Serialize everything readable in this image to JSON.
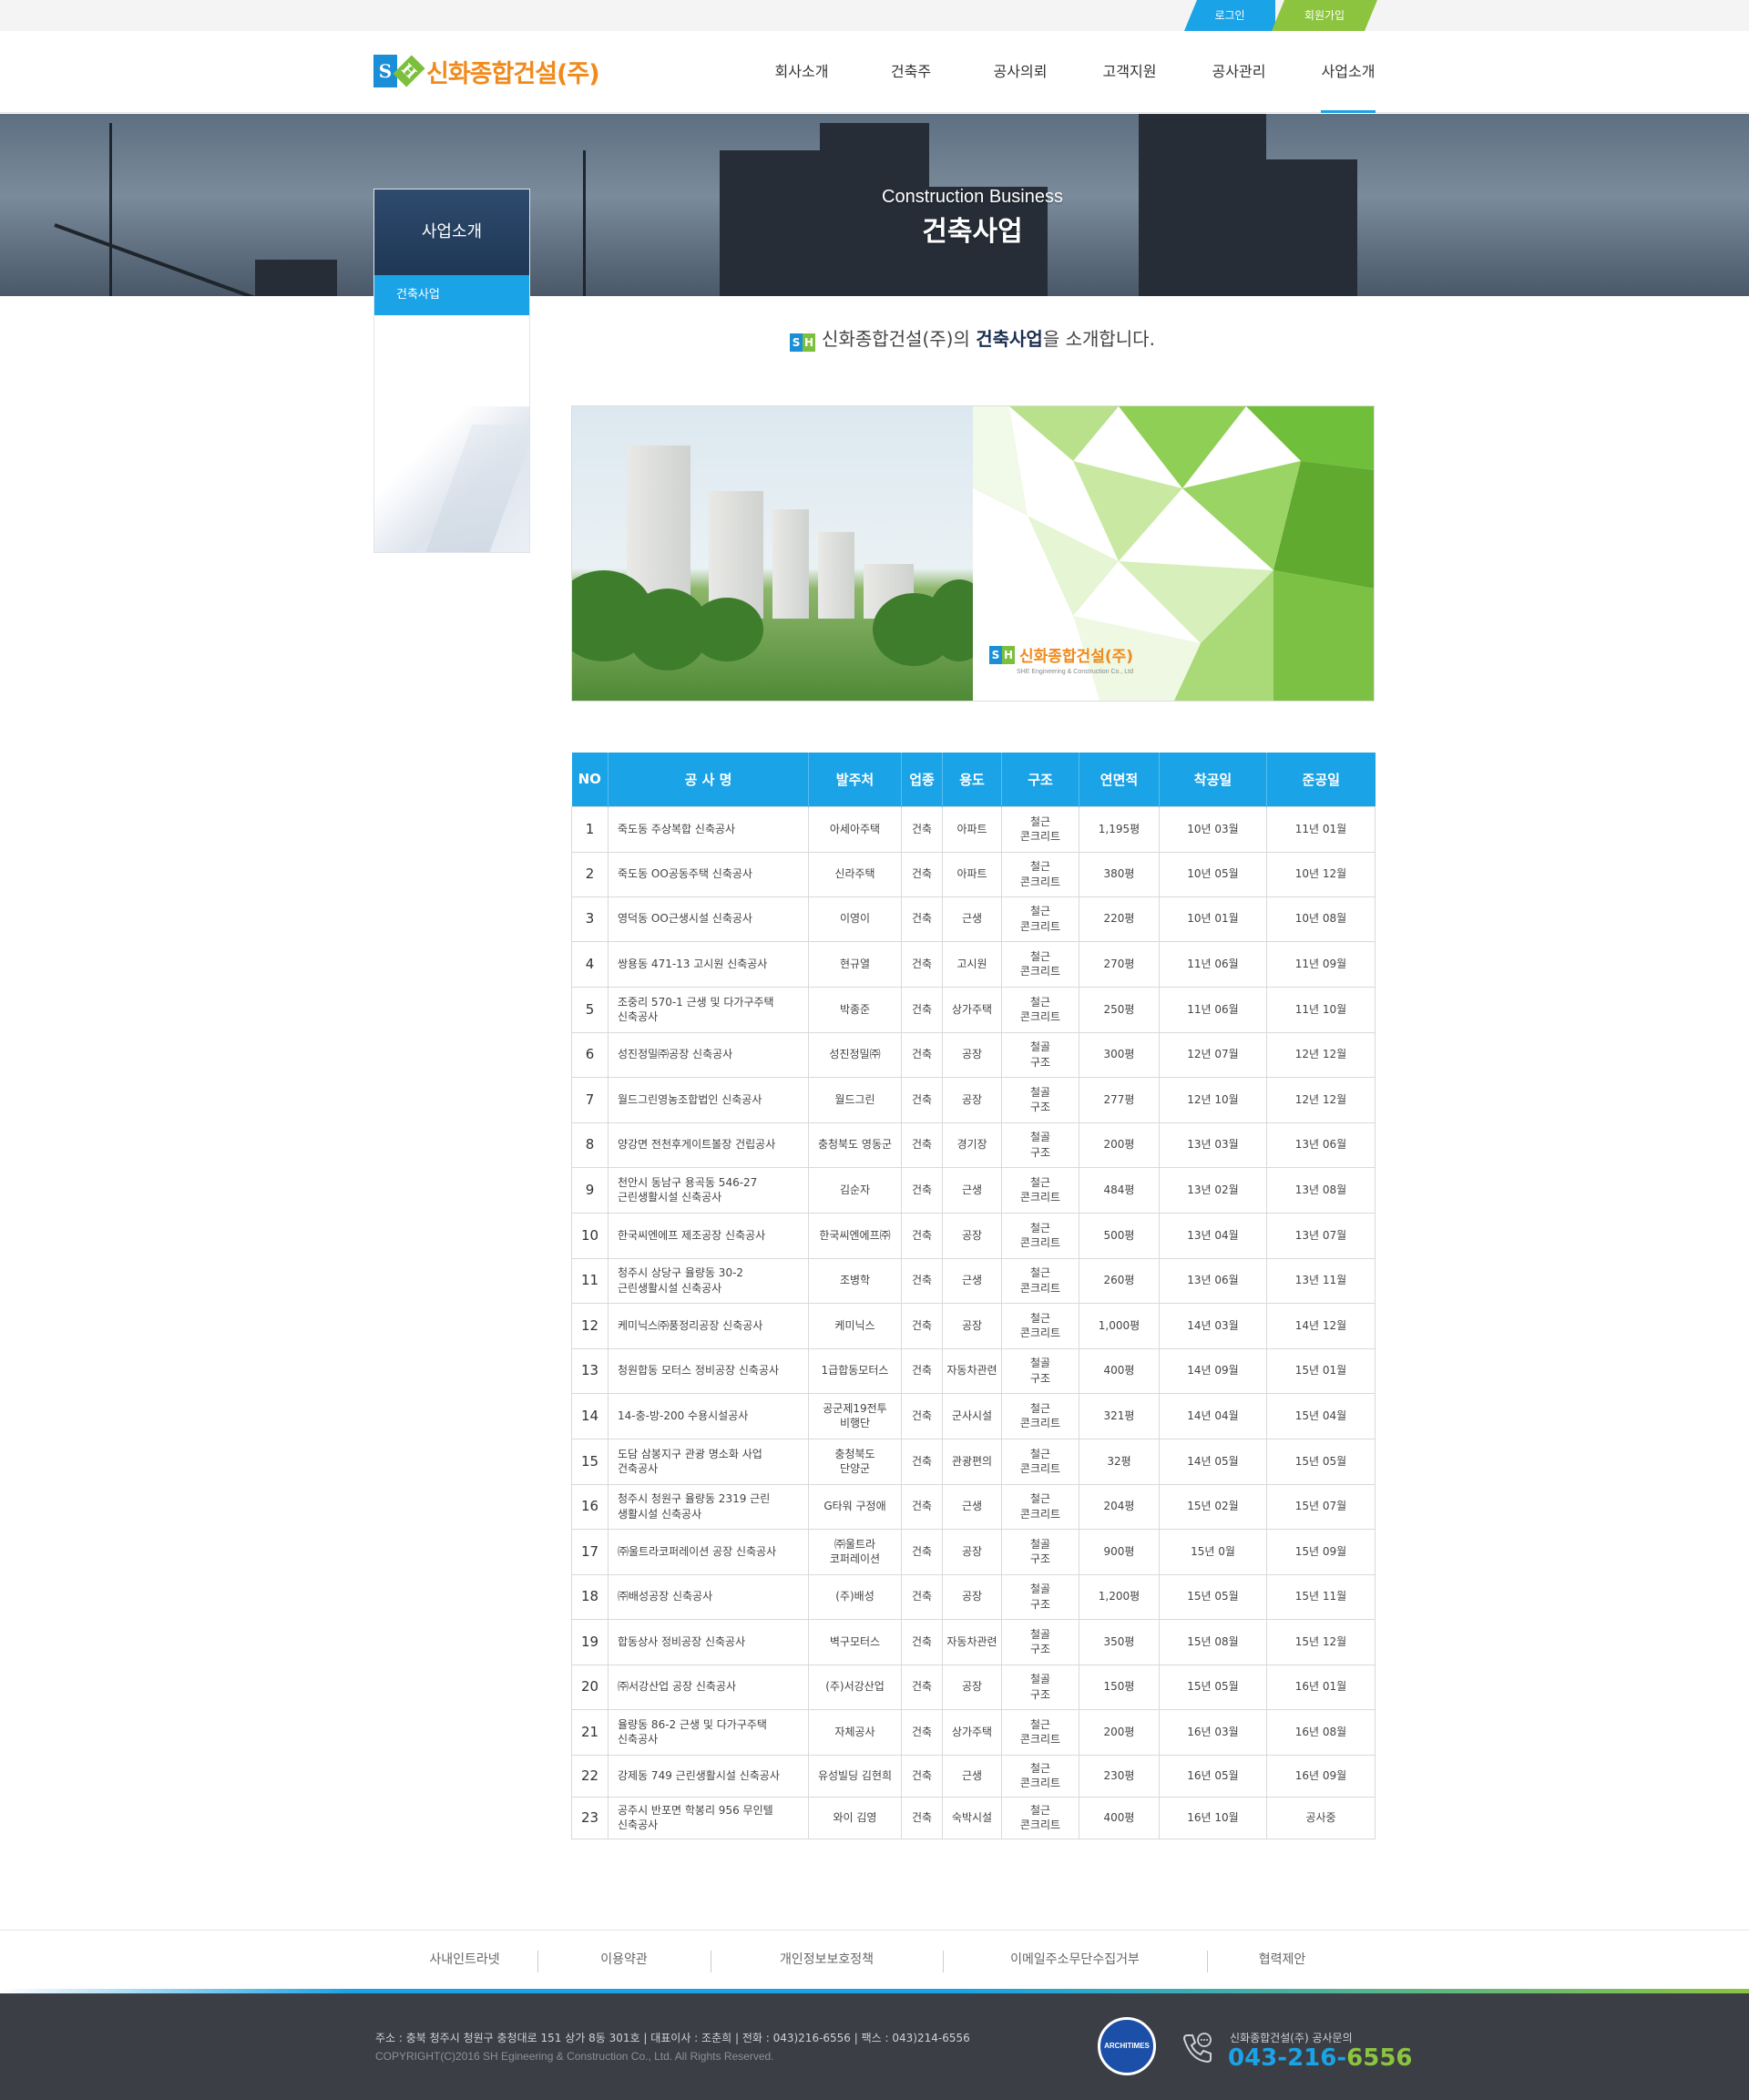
{
  "util": {
    "login": "로그인",
    "join": "회원가입"
  },
  "header": {
    "logo_mark_s": "S",
    "logo_mark_h": "H",
    "logo_name": "신화종합건설(주)",
    "nav": [
      "회사소개",
      "건축주",
      "공사의뢰",
      "고객지원",
      "공사관리",
      "사업소개"
    ],
    "active_nav": "사업소개"
  },
  "visual": {
    "subtitle_en": "Construction Business",
    "title": "건축사업"
  },
  "lnb": {
    "title": "사업소개",
    "items": [
      "건축사업"
    ]
  },
  "intro": {
    "prefix": "신화종합건설(주)의 ",
    "highlight": "건축사업",
    "suffix": "을 소개합니다."
  },
  "hero": {
    "logo_name": "신화종합건설(주)",
    "logo_sub": "SHE Engineering & Construction Co., Ltd"
  },
  "table": {
    "headers": [
      "NO",
      "공 사 명",
      "발주처",
      "업종",
      "용도",
      "구조",
      "연면적",
      "착공일",
      "준공일"
    ],
    "rows": [
      {
        "no": "1",
        "name": "죽도동 주상복합 신축공사",
        "client": "아세아주택",
        "type": "건축",
        "use": "아파트",
        "struct": "철근\n콘크리트",
        "area": "1,195평",
        "start": "10년 03월",
        "end": "11년 01월"
      },
      {
        "no": "2",
        "name": "죽도동 OO공동주택 신축공사",
        "client": "신라주택",
        "type": "건축",
        "use": "아파트",
        "struct": "철근\n콘크리트",
        "area": "380평",
        "start": "10년 05월",
        "end": "10년 12월"
      },
      {
        "no": "3",
        "name": "영덕동 OO근생시설 신축공사",
        "client": "이영이",
        "type": "건축",
        "use": "근생",
        "struct": "철근\n콘크리트",
        "area": "220평",
        "start": "10년 01월",
        "end": "10년 08월"
      },
      {
        "no": "4",
        "name": "쌍용동 471-13 고시원 신축공사",
        "client": "현규열",
        "type": "건축",
        "use": "고시원",
        "struct": "철근\n콘크리트",
        "area": "270평",
        "start": "11년 06월",
        "end": "11년 09월"
      },
      {
        "no": "5",
        "name": "조중리 570-1 근생 및 다가구주택\n신축공사",
        "client": "박종준",
        "type": "건축",
        "use": "상가주택",
        "struct": "철근\n콘크리트",
        "area": "250평",
        "start": "11년 06월",
        "end": "11년 10월"
      },
      {
        "no": "6",
        "name": "성진정밀㈜공장 신축공사",
        "client": "성진정밀㈜",
        "type": "건축",
        "use": "공장",
        "struct": "철골\n구조",
        "area": "300평",
        "start": "12년 07월",
        "end": "12년 12월"
      },
      {
        "no": "7",
        "name": "월드그린영농조합법인 신축공사",
        "client": "월드그린",
        "type": "건축",
        "use": "공장",
        "struct": "철골\n구조",
        "area": "277평",
        "start": "12년 10월",
        "end": "12년 12월"
      },
      {
        "no": "8",
        "name": "양강면 전천후게이트볼장 건립공사",
        "client": "충청북도 영동군",
        "type": "건축",
        "use": "경기장",
        "struct": "철골\n구조",
        "area": "200평",
        "start": "13년 03월",
        "end": "13년 06월"
      },
      {
        "no": "9",
        "name": "천안시 동남구 용곡동 546-27\n근린생활시설 신축공사",
        "client": "김순자",
        "type": "건축",
        "use": "근생",
        "struct": "철근\n콘크리트",
        "area": "484평",
        "start": "13년 02월",
        "end": "13년 08월"
      },
      {
        "no": "10",
        "name": "한국씨엔에프 제조공장 신축공사",
        "client": "한국씨엔에프㈜",
        "type": "건축",
        "use": "공장",
        "struct": "철근\n콘크리트",
        "area": "500평",
        "start": "13년 04월",
        "end": "13년 07월"
      },
      {
        "no": "11",
        "name": "청주시 상당구 율량동 30-2\n근린생활시설 신축공사",
        "client": "조병학",
        "type": "건축",
        "use": "근생",
        "struct": "철근\n콘크리트",
        "area": "260평",
        "start": "13년 06월",
        "end": "13년 11월"
      },
      {
        "no": "12",
        "name": "케미닉스㈜풍정리공장 신축공사",
        "client": "케미닉스",
        "type": "건축",
        "use": "공장",
        "struct": "철근\n콘크리트",
        "area": "1,000평",
        "start": "14년 03월",
        "end": "14년 12월"
      },
      {
        "no": "13",
        "name": "청원합동 모터스 정비공장 신축공사",
        "client": "1급합동모터스",
        "type": "건축",
        "use": "자동차관련",
        "struct": "철골\n구조",
        "area": "400평",
        "start": "14년 09월",
        "end": "15년 01월"
      },
      {
        "no": "14",
        "name": "14-충-방-200 수용시설공사",
        "client": "공군제19전투\n비행단",
        "type": "건축",
        "use": "군사시설",
        "struct": "철근\n콘크리트",
        "area": "321평",
        "start": "14년 04월",
        "end": "15년 04월"
      },
      {
        "no": "15",
        "name": "도담 삼봉지구 관광 명소화 사업\n건축공사",
        "client": "충청북도\n단양군",
        "type": "건축",
        "use": "관광편의",
        "struct": "철근\n콘크리트",
        "area": "32평",
        "start": "14년 05월",
        "end": "15년 05월"
      },
      {
        "no": "16",
        "name": "청주시 청원구 율량동 2319 근린\n생활시설 신축공사",
        "client": "G타워 구정애",
        "type": "건축",
        "use": "근생",
        "struct": "철근\n콘크리트",
        "area": "204평",
        "start": "15년 02월",
        "end": "15년 07월"
      },
      {
        "no": "17",
        "name": "㈜울트라코퍼레이션 공장 신축공사",
        "client": "㈜울트라\n코퍼레이션",
        "type": "건축",
        "use": "공장",
        "struct": "철골\n구조",
        "area": "900평",
        "start": "15년 0월",
        "end": "15년 09월"
      },
      {
        "no": "18",
        "name": "㈜배성공장 신축공사",
        "client": "(주)배성",
        "type": "건축",
        "use": "공장",
        "struct": "철골\n구조",
        "area": "1,200평",
        "start": "15년 05월",
        "end": "15년 11월"
      },
      {
        "no": "19",
        "name": "합동상사 정비공장 신축공사",
        "client": "벽구모터스",
        "type": "건축",
        "use": "자동차관련",
        "struct": "철골\n구조",
        "area": "350평",
        "start": "15년 08월",
        "end": "15년 12월"
      },
      {
        "no": "20",
        "name": "㈜서강산업 공장 신축공사",
        "client": "(주)서강산업",
        "type": "건축",
        "use": "공장",
        "struct": "철골\n구조",
        "area": "150평",
        "start": "15년 05월",
        "end": "16년 01월"
      },
      {
        "no": "21",
        "name": "율량동 86-2 근생 및 다가구주택\n신축공사",
        "client": "자체공사",
        "type": "건축",
        "use": "상가주택",
        "struct": "철근\n콘크리트",
        "area": "200평",
        "start": "16년 03월",
        "end": "16년 08월"
      },
      {
        "no": "22",
        "name": "강제동 749 근린생활시설 신축공사",
        "client": "유성빌딩 김현희",
        "type": "건축",
        "use": "근생",
        "struct": "철근\n콘크리트",
        "area": "230평",
        "start": "16년 05월",
        "end": "16년 09월"
      },
      {
        "no": "23",
        "name": "공주시 반포면 학봉리 956 무인텔\n신축공사",
        "client": "와이 김영",
        "type": "건축",
        "use": "숙박시설",
        "struct": "철근\n콘크리트",
        "area": "400평",
        "start": "16년 10월",
        "end": "공사중"
      }
    ]
  },
  "footer": {
    "links": [
      "사내인트라넷",
      "이용약관",
      "개인정보보호정책",
      "이메일주소무단수집거부",
      "협력제안"
    ],
    "address": "주소 : 충북 청주시 청원구 충청대로 151 상가 8동 301호  |  대표이사 : 조춘희  |  전화 : 043)216-6556  |  팩스 : 043)214-6556",
    "copyright": "COPYRIGHT(C)2016  SH Egineering & Construction  Co., Ltd. All Rights Reserved.",
    "cert": "ARCHITIMES",
    "cs_label": "신화종합건설(주) 공사문의",
    "cs_tel_a": "043-216-",
    "cs_tel_b": "6556"
  },
  "colors": {
    "primary": "#1aa3e6",
    "accent_green": "#8cc43f",
    "logo_orange": "#f08a1c",
    "footer_bg": "#3b3e44"
  }
}
